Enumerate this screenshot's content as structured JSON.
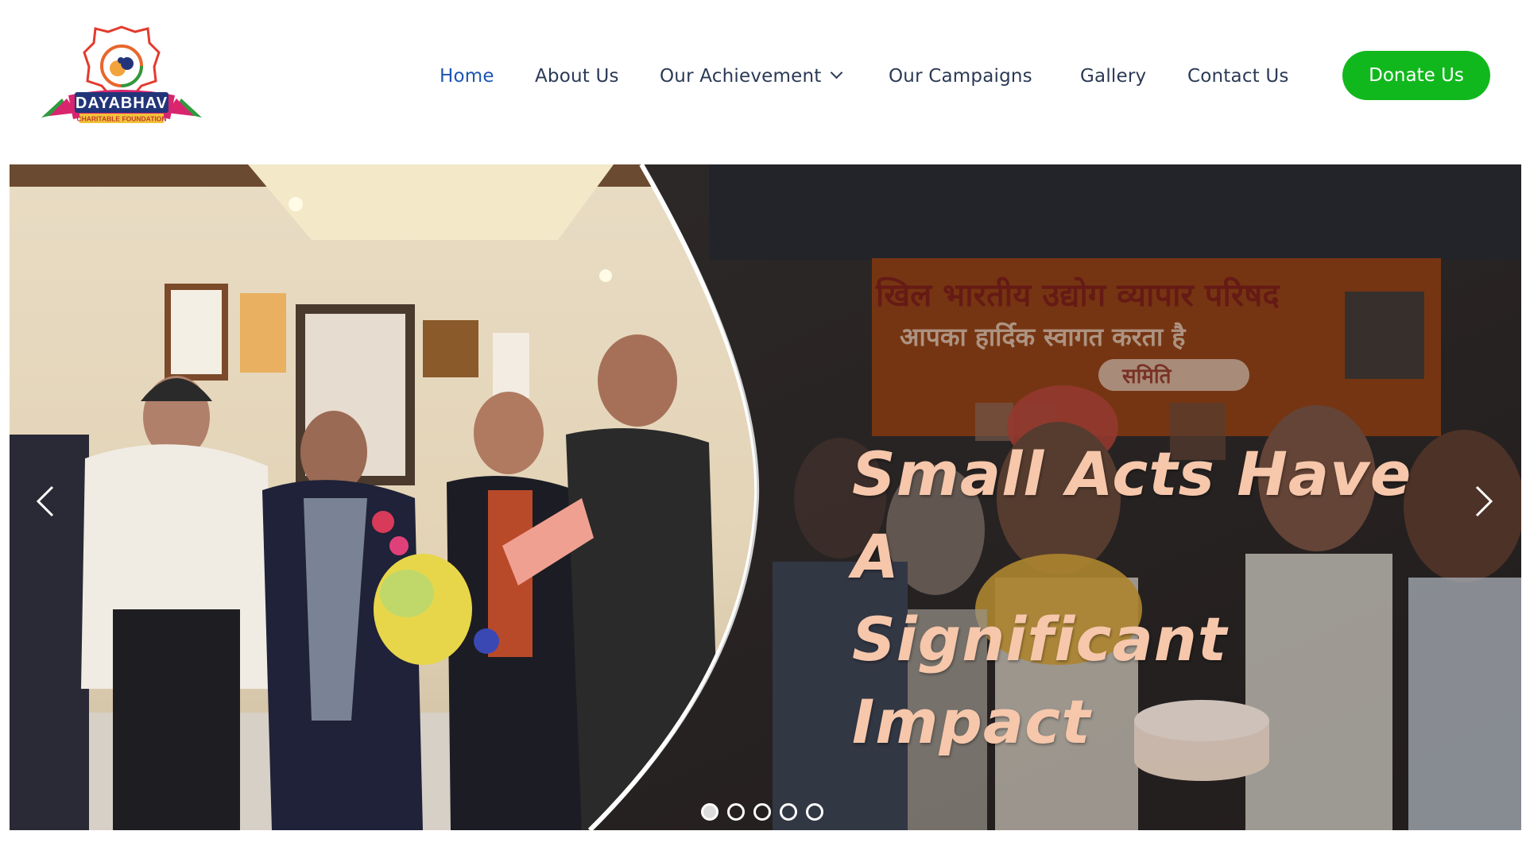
{
  "brand": {
    "logo_text": "DAYABHAV",
    "logo_subtext": "CHARITABLE FOUNDATION",
    "colors": {
      "orange": "#e8662b",
      "navy": "#23357a",
      "pink": "#d8256e",
      "green": "#2e9a3d"
    }
  },
  "nav": {
    "items": [
      {
        "label": "Home",
        "active": true
      },
      {
        "label": "About Us"
      },
      {
        "label": "Our Achievement",
        "dropdown": true
      },
      {
        "label": "Our Campaigns"
      },
      {
        "label": "Gallery"
      },
      {
        "label": "Contact Us"
      }
    ],
    "text_color": "#2b3a55",
    "active_color": "#1c55b4"
  },
  "donate": {
    "label": "Donate Us",
    "color": "#11b81d"
  },
  "hero": {
    "headline_line1": "Small Acts Have A",
    "headline_line2": "Significant Impact",
    "headline_color": "#f6c7ab",
    "banner_text_line1": "खिल भारतीय उद्योग व्यापार परिषद",
    "banner_text_line2": "आपका हार्दिक स्वागत करता है",
    "banner_text_line3": "समिति",
    "prev_icon": "chevron-left-icon",
    "next_icon": "chevron-right-icon",
    "slide_count": 5,
    "active_slide": 1
  }
}
